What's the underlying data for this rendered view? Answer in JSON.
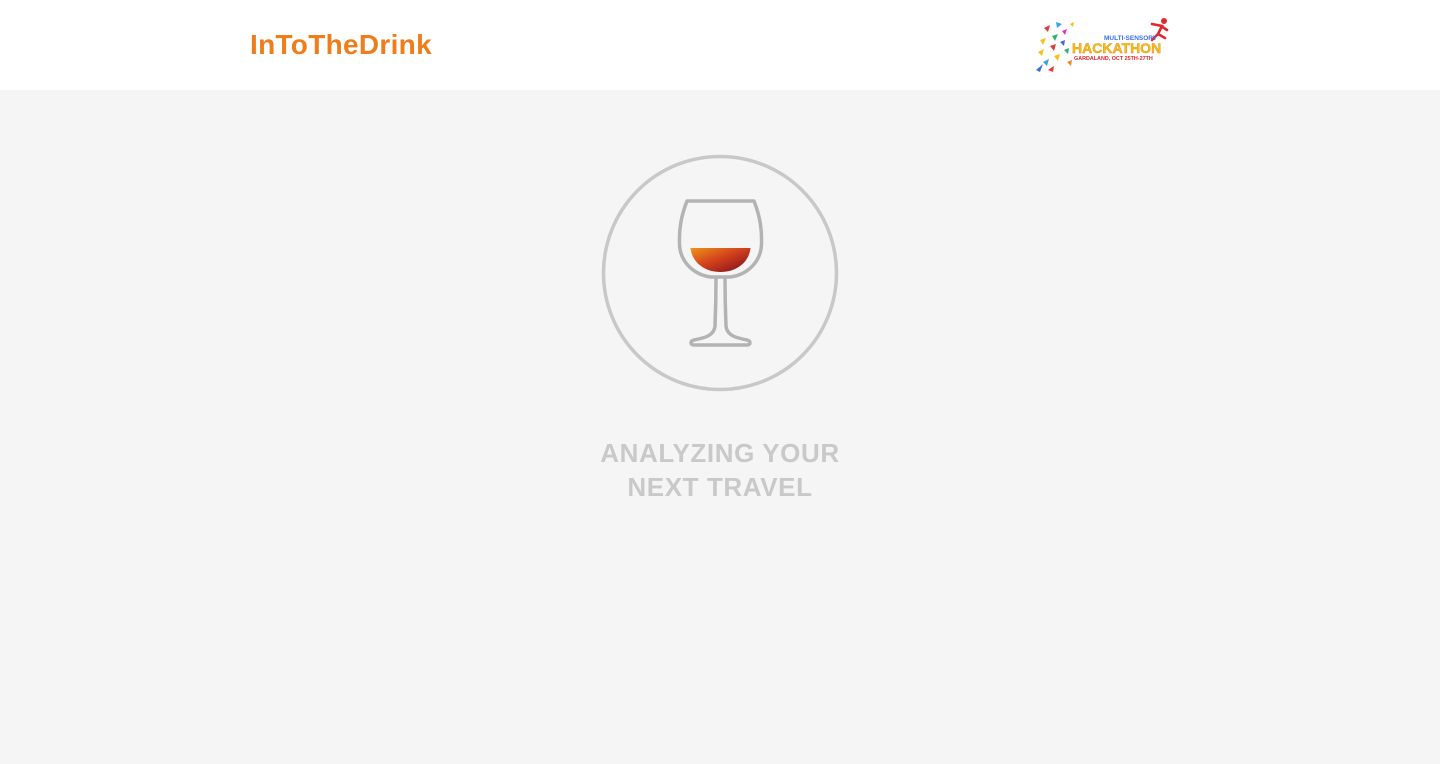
{
  "header": {
    "brand": "InToTheDrink",
    "event_logo": {
      "top_line": "MULTI-SENSORY",
      "main_word": "HACKATHON",
      "sub_line": "GARDALAND, OCT 25TH-27TH",
      "icon": "running-figure-confetti-icon"
    }
  },
  "main": {
    "loader_icon": "wine-glass-icon",
    "status_line1": "ANALYZING YOUR",
    "status_line2": "NEXT TRAVEL"
  },
  "colors": {
    "brand": "#ee7d1b",
    "background": "#f5f5f5",
    "header_bg": "#ffffff",
    "ring": "#c8c8c8",
    "glass": "#b3b3b3",
    "wine_top": "#e8850f",
    "wine_bottom": "#8a0c1c",
    "status_text": "#c9c9c9"
  }
}
